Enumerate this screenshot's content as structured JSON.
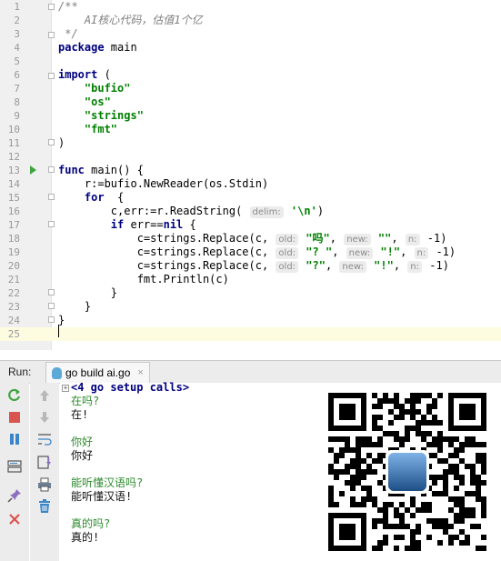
{
  "editor": {
    "lines": [
      {
        "n": "1",
        "segs": [
          {
            "t": "/**",
            "c": "cm"
          }
        ]
      },
      {
        "n": "2",
        "segs": [
          {
            "t": "    AI核心代码，估值1个亿",
            "c": "cm"
          }
        ]
      },
      {
        "n": "3",
        "segs": [
          {
            "t": " */",
            "c": "cm"
          }
        ]
      },
      {
        "n": "4",
        "segs": [
          {
            "t": "package",
            "c": "kw"
          },
          {
            "t": " main"
          }
        ]
      },
      {
        "n": "5",
        "segs": []
      },
      {
        "n": "6",
        "segs": [
          {
            "t": "import",
            "c": "kw"
          },
          {
            "t": " ("
          }
        ]
      },
      {
        "n": "7",
        "segs": [
          {
            "t": "    "
          },
          {
            "t": "\"bufio\"",
            "c": "str"
          }
        ]
      },
      {
        "n": "8",
        "segs": [
          {
            "t": "    "
          },
          {
            "t": "\"os\"",
            "c": "str"
          }
        ]
      },
      {
        "n": "9",
        "segs": [
          {
            "t": "    "
          },
          {
            "t": "\"strings\"",
            "c": "str"
          }
        ]
      },
      {
        "n": "10",
        "segs": [
          {
            "t": "    "
          },
          {
            "t": "\"fmt\"",
            "c": "str"
          }
        ]
      },
      {
        "n": "11",
        "segs": [
          {
            "t": ")"
          }
        ]
      },
      {
        "n": "12",
        "segs": []
      },
      {
        "n": "13",
        "segs": [
          {
            "t": "func",
            "c": "kw"
          },
          {
            "t": " main() {"
          }
        ]
      },
      {
        "n": "14",
        "segs": [
          {
            "t": "    r:=bufio.NewReader(os.Stdin)"
          }
        ]
      },
      {
        "n": "15",
        "segs": [
          {
            "t": "    "
          },
          {
            "t": "for",
            "c": "kw"
          },
          {
            "t": "  {"
          }
        ]
      },
      {
        "n": "16",
        "segs": [
          {
            "t": "        c,err:=r.ReadString( "
          },
          {
            "t": "delim:",
            "c": "hint"
          },
          {
            "t": " "
          },
          {
            "t": "'\\n'",
            "c": "str"
          },
          {
            "t": ")"
          }
        ]
      },
      {
        "n": "17",
        "segs": [
          {
            "t": "        "
          },
          {
            "t": "if",
            "c": "kw"
          },
          {
            "t": " err=="
          },
          {
            "t": "nil",
            "c": "kw"
          },
          {
            "t": " {"
          }
        ]
      },
      {
        "n": "18",
        "segs": [
          {
            "t": "            c=strings.Replace(c, "
          },
          {
            "t": "old:",
            "c": "hint"
          },
          {
            "t": " "
          },
          {
            "t": "\"吗\"",
            "c": "str"
          },
          {
            "t": ", "
          },
          {
            "t": "new:",
            "c": "hint"
          },
          {
            "t": " "
          },
          {
            "t": "\"\"",
            "c": "str"
          },
          {
            "t": ", "
          },
          {
            "t": "n:",
            "c": "hint"
          },
          {
            "t": " -1)"
          }
        ]
      },
      {
        "n": "19",
        "segs": [
          {
            "t": "            c=strings.Replace(c, "
          },
          {
            "t": "old:",
            "c": "hint"
          },
          {
            "t": " "
          },
          {
            "t": "\"? \"",
            "c": "str"
          },
          {
            "t": ", "
          },
          {
            "t": "new:",
            "c": "hint"
          },
          {
            "t": " "
          },
          {
            "t": "\"!\"",
            "c": "str"
          },
          {
            "t": ", "
          },
          {
            "t": "n:",
            "c": "hint"
          },
          {
            "t": " -1)"
          }
        ]
      },
      {
        "n": "20",
        "segs": [
          {
            "t": "            c=strings.Replace(c, "
          },
          {
            "t": "old:",
            "c": "hint"
          },
          {
            "t": " "
          },
          {
            "t": "\"?\"",
            "c": "str"
          },
          {
            "t": ", "
          },
          {
            "t": "new:",
            "c": "hint"
          },
          {
            "t": " "
          },
          {
            "t": "\"!\"",
            "c": "str"
          },
          {
            "t": ", "
          },
          {
            "t": "n:",
            "c": "hint"
          },
          {
            "t": " -1)"
          }
        ]
      },
      {
        "n": "21",
        "segs": [
          {
            "t": "            fmt.Println(c)"
          }
        ]
      },
      {
        "n": "22",
        "segs": [
          {
            "t": "        }"
          }
        ]
      },
      {
        "n": "23",
        "segs": [
          {
            "t": "    }"
          }
        ]
      },
      {
        "n": "24",
        "segs": [
          {
            "t": "}"
          }
        ]
      },
      {
        "n": "25",
        "segs": []
      }
    ]
  },
  "run": {
    "label": "Run:",
    "tab_label": "go build ai.go",
    "tab_close": "×"
  },
  "console": {
    "header": "<4 go setup calls>",
    "lines": [
      {
        "t": "在吗?",
        "k": "in"
      },
      {
        "t": "在!",
        "k": "out"
      },
      {
        "t": "",
        "k": "out"
      },
      {
        "t": "你好",
        "k": "in"
      },
      {
        "t": "你好",
        "k": "out"
      },
      {
        "t": "",
        "k": "out"
      },
      {
        "t": "能听懂汉语吗?",
        "k": "in"
      },
      {
        "t": "能听懂汉语!",
        "k": "out"
      },
      {
        "t": "",
        "k": "out"
      },
      {
        "t": "真的吗?",
        "k": "in"
      },
      {
        "t": "真的!",
        "k": "out"
      }
    ]
  },
  "icons": [
    "rerun-icon",
    "stop-icon",
    "pause-icon",
    "layout-icon",
    "pin-icon",
    "close-icon",
    "up-arrow-icon",
    "down-arrow-icon",
    "soft-wrap-icon",
    "scroll-to-end-icon",
    "print-icon",
    "trash-icon",
    "run-gutter-icon",
    "gopher-icon",
    "qr-code-image"
  ],
  "colors": {
    "keyword": "#000080",
    "string": "#008000",
    "comment": "#808080",
    "input": "#2e8b2e",
    "run": "#3fa43f",
    "stop": "#d9534f"
  }
}
